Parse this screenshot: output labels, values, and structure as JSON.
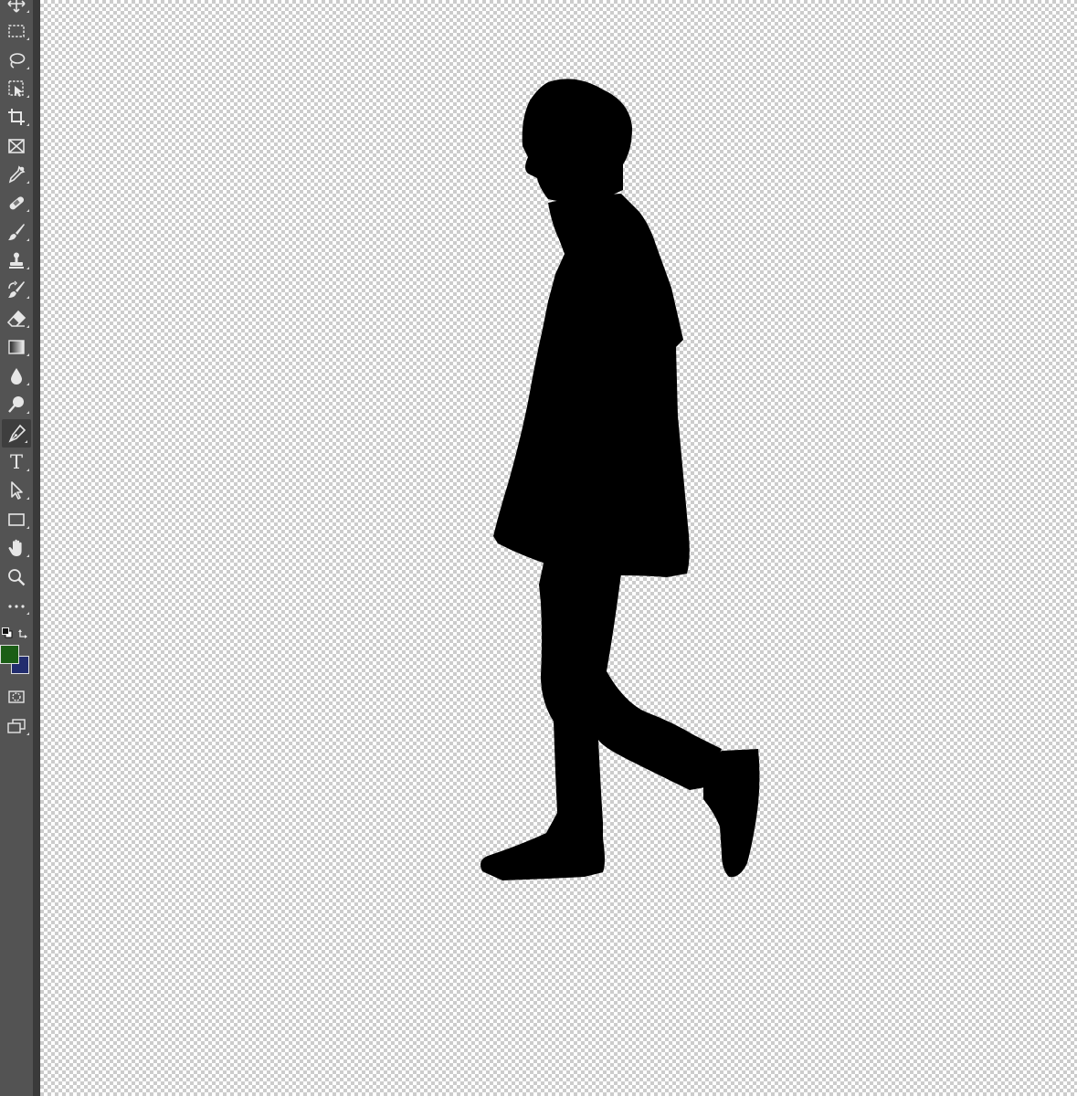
{
  "toolbar": {
    "tools": [
      {
        "name": "move-tool",
        "icon": "move-icon"
      },
      {
        "name": "rectangular-marquee-tool",
        "icon": "marquee-icon"
      },
      {
        "name": "lasso-tool",
        "icon": "lasso-icon"
      },
      {
        "name": "object-selection-tool",
        "icon": "object-selection-icon"
      },
      {
        "name": "crop-tool",
        "icon": "crop-icon"
      },
      {
        "name": "frame-tool",
        "icon": "frame-icon"
      },
      {
        "name": "eyedropper-tool",
        "icon": "eyedropper-icon"
      },
      {
        "name": "spot-healing-brush-tool",
        "icon": "bandage-icon"
      },
      {
        "name": "brush-tool",
        "icon": "brush-icon"
      },
      {
        "name": "clone-stamp-tool",
        "icon": "stamp-icon"
      },
      {
        "name": "history-brush-tool",
        "icon": "history-brush-icon"
      },
      {
        "name": "eraser-tool",
        "icon": "eraser-icon"
      },
      {
        "name": "gradient-tool",
        "icon": "gradient-icon"
      },
      {
        "name": "blur-tool",
        "icon": "drop-icon"
      },
      {
        "name": "dodge-tool",
        "icon": "dodge-icon"
      },
      {
        "name": "pen-tool",
        "icon": "pen-icon",
        "active": true
      },
      {
        "name": "type-tool",
        "icon": "type-icon"
      },
      {
        "name": "path-selection-tool",
        "icon": "arrow-icon"
      },
      {
        "name": "rectangle-tool",
        "icon": "rectangle-icon"
      },
      {
        "name": "hand-tool",
        "icon": "hand-icon"
      },
      {
        "name": "zoom-tool",
        "icon": "zoom-icon"
      },
      {
        "name": "edit-toolbar",
        "icon": "ellipsis-icon"
      }
    ],
    "type_tool_glyph": "T",
    "colors": {
      "foreground": "#1b5e16",
      "background": "#222d6e",
      "toolbar_bg": "#535353",
      "icon": "#e6e6e6"
    },
    "bottom_tools": [
      {
        "name": "quick-mask-button",
        "icon": "quick-mask-icon"
      },
      {
        "name": "screen-mode-button",
        "icon": "screen-mode-icon"
      }
    ]
  },
  "canvas": {
    "transparency": "checkerboard",
    "subject": "walking-person-silhouette",
    "silhouette_color": "#000000"
  }
}
